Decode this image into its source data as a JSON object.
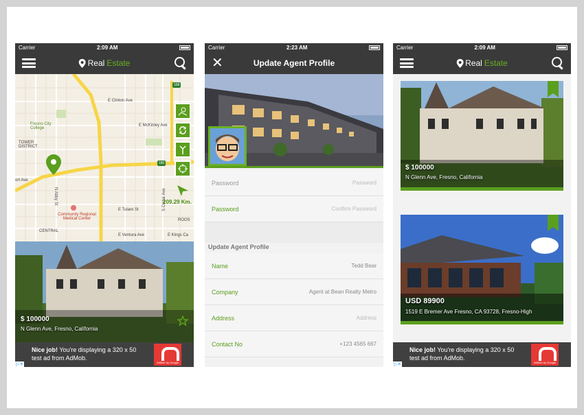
{
  "phone1": {
    "status": {
      "carrier": "Carrier",
      "time": "2:09 AM"
    },
    "brand": {
      "part1": "Real",
      "part2": "Estate"
    },
    "map": {
      "labels": [
        "E Clinton Ave",
        "E McKinley Ave",
        "Fresno City College",
        "TOWER DISTRICT",
        "E Tulare St",
        "Community Regional Medical Center",
        "CENTRAL",
        "E Ventura Ave",
        "E Kings Ca",
        "N Abby St",
        "S Cedar Ave",
        "ROOS",
        "ort Ave"
      ],
      "distance": "209.29 Km.",
      "highway_shields": [
        "168",
        "180"
      ]
    },
    "listing": {
      "price": "$ 100000",
      "address": "N Glenn Ave, Fresno, California"
    },
    "ad": {
      "line1_bold": "Nice job!",
      "line1": " You're displaying a 320 x 50",
      "line2": "test ad from AdMob.",
      "logo_caption": "AdMob by Google"
    }
  },
  "phone2": {
    "status": {
      "carrier": "Carrier",
      "time": "2:23 AM"
    },
    "title": "Update Agent Profile",
    "fields_top": [
      {
        "label": "Password",
        "value": "Password"
      },
      {
        "label": "Password",
        "value": "Confirm Password"
      }
    ],
    "section_title": "Update Agent Profile",
    "fields": [
      {
        "label": "Name",
        "value": "Tedd Bear"
      },
      {
        "label": "Company",
        "value": "Agent at Bean Realty Metro"
      },
      {
        "label": "Address",
        "value": "Address"
      },
      {
        "label": "Contact No",
        "value": "+123 4565 667"
      }
    ]
  },
  "phone3": {
    "status": {
      "carrier": "Carrier",
      "time": "2:09 AM"
    },
    "brand": {
      "part1": "Real",
      "part2": "Estate"
    },
    "listings": [
      {
        "price": "$ 100000",
        "address": "N Glenn Ave, Fresno, California"
      },
      {
        "price": "USD 89900",
        "address": "1519 E Bremer Ave Fresno, CA 93728, Fresno-High"
      }
    ],
    "ad": {
      "line1_bold": "Nice job!",
      "line1": " You're displaying a 320 x 50",
      "line2": "test ad from AdMob.",
      "logo_caption": "AdMob by Google"
    }
  },
  "colors": {
    "accent": "#5b9f1e",
    "navbar": "#3a3a3a",
    "ad_red": "#e53935"
  }
}
